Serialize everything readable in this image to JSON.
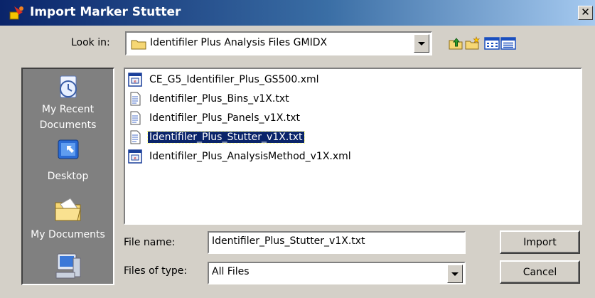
{
  "window": {
    "title": "Import Marker Stutter",
    "close_glyph": "✕"
  },
  "lookin": {
    "label": "Look in:",
    "value": "Identifiler Plus Analysis Files GMIDX",
    "folder_icon": "folder-icon"
  },
  "toolbar": {
    "icons": [
      "up-folder-icon",
      "new-folder-icon",
      "list-view-icon",
      "details-view-icon"
    ]
  },
  "places": {
    "items": [
      {
        "label": "My Recent\nDocuments",
        "icon": "recent-documents-icon"
      },
      {
        "label": "Desktop",
        "icon": "desktop-icon"
      },
      {
        "label": "My Documents",
        "icon": "my-documents-icon"
      },
      {
        "label": "",
        "icon": "my-computer-icon"
      }
    ]
  },
  "files": [
    {
      "name": "CE_G5_Identifiler_Plus_GS500.xml",
      "type": "xml",
      "selected": false
    },
    {
      "name": "Identifiler_Plus_Bins_v1X.txt",
      "type": "txt",
      "selected": false
    },
    {
      "name": "Identifiler_Plus_Panels_v1X.txt",
      "type": "txt",
      "selected": false
    },
    {
      "name": "Identifiler_Plus_Stutter_v1X.txt",
      "type": "txt",
      "selected": true
    },
    {
      "name": "Identifiler_Plus_AnalysisMethod_v1X.xml",
      "type": "xml",
      "selected": false
    }
  ],
  "form": {
    "filename_label": "File name:",
    "filename_value": "Identifiler_Plus_Stutter_v1X.txt",
    "filetype_label": "Files of type:",
    "filetype_value": "All Files"
  },
  "buttons": {
    "import": "Import",
    "cancel": "Cancel"
  }
}
